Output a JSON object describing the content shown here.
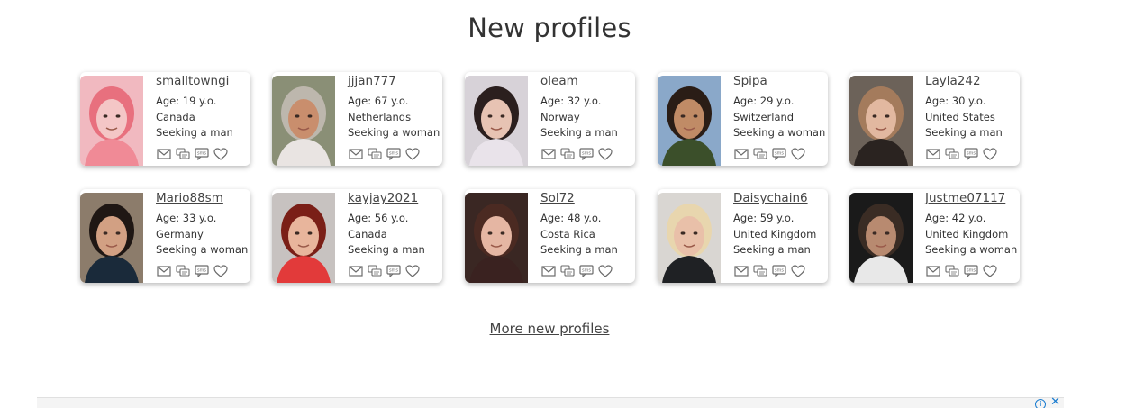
{
  "header": {
    "title": "New profiles"
  },
  "icons": {
    "mail": "mail-icon",
    "chat": "chat-icon",
    "sms": "sms-icon",
    "favorite": "heart-icon"
  },
  "sms_label": "sms",
  "profiles": [
    {
      "name": "smalltowngi",
      "age": "Age: 19 y.o.",
      "country": "Canada",
      "seeking": "Seeking a man"
    },
    {
      "name": "jjjan777",
      "age": "Age: 67 y.o.",
      "country": "Netherlands",
      "seeking": "Seeking a woman"
    },
    {
      "name": "oleam",
      "age": "Age: 32 y.o.",
      "country": "Norway",
      "seeking": "Seeking a man"
    },
    {
      "name": "Spipa",
      "age": "Age: 29 y.o.",
      "country": "Switzerland",
      "seeking": "Seeking a woman"
    },
    {
      "name": "Layla242",
      "age": "Age: 30 y.o.",
      "country": "United States",
      "seeking": "Seeking a man"
    },
    {
      "name": "Mario88sm",
      "age": "Age: 33 y.o.",
      "country": "Germany",
      "seeking": "Seeking a woman"
    },
    {
      "name": "kayjay2021",
      "age": "Age: 56 y.o.",
      "country": "Canada",
      "seeking": "Seeking a man"
    },
    {
      "name": "Sol72",
      "age": "Age: 48 y.o.",
      "country": "Costa Rica",
      "seeking": "Seeking a man"
    },
    {
      "name": "Daisychain6",
      "age": "Age: 59 y.o.",
      "country": "United Kingdom",
      "seeking": "Seeking a man"
    },
    {
      "name": "Justme07117",
      "age": "Age: 42 y.o.",
      "country": "United Kingdom",
      "seeking": "Seeking a woman"
    }
  ],
  "photo_colors": [
    {
      "bg": "#f1b9c0",
      "hair": "#e8707e",
      "skin": "#f4c6c6",
      "shirt": "#f08a96"
    },
    {
      "bg": "#8a8f76",
      "hair": "#bdb7ad",
      "skin": "#c98e6d",
      "shirt": "#e9e4e2"
    },
    {
      "bg": "#d7d2d8",
      "hair": "#2b1f1e",
      "skin": "#e7c3b3",
      "shirt": "#e9e3ea"
    },
    {
      "bg": "#8aa8c9",
      "hair": "#2a1d16",
      "skin": "#c08b66",
      "shirt": "#3b4f2a"
    },
    {
      "bg": "#6c6259",
      "hair": "#a47b5c",
      "skin": "#e2b8a0",
      "shirt": "#2a2320"
    },
    {
      "bg": "#8c7c6b",
      "hair": "#1f1714",
      "skin": "#d2a083",
      "shirt": "#1a2a3a"
    },
    {
      "bg": "#c7c2c0",
      "hair": "#7a1f17",
      "skin": "#e8b59c",
      "shirt": "#e23a3a"
    },
    {
      "bg": "#3a2723",
      "hair": "#4b2a22",
      "skin": "#e5b6a3",
      "shirt": "#3a2220"
    },
    {
      "bg": "#d9d6d2",
      "hair": "#e8d6ae",
      "skin": "#e9c0a9",
      "shirt": "#1f2124"
    },
    {
      "bg": "#1a1a1a",
      "hair": "#3a2c24",
      "skin": "#b88a70",
      "shirt": "#e8e8e8"
    }
  ],
  "footer": {
    "more_link": "More new profiles"
  },
  "ad": {
    "info_icon": "info-icon",
    "close_icon": "close-icon"
  },
  "accent_color": "#1a7cd0"
}
